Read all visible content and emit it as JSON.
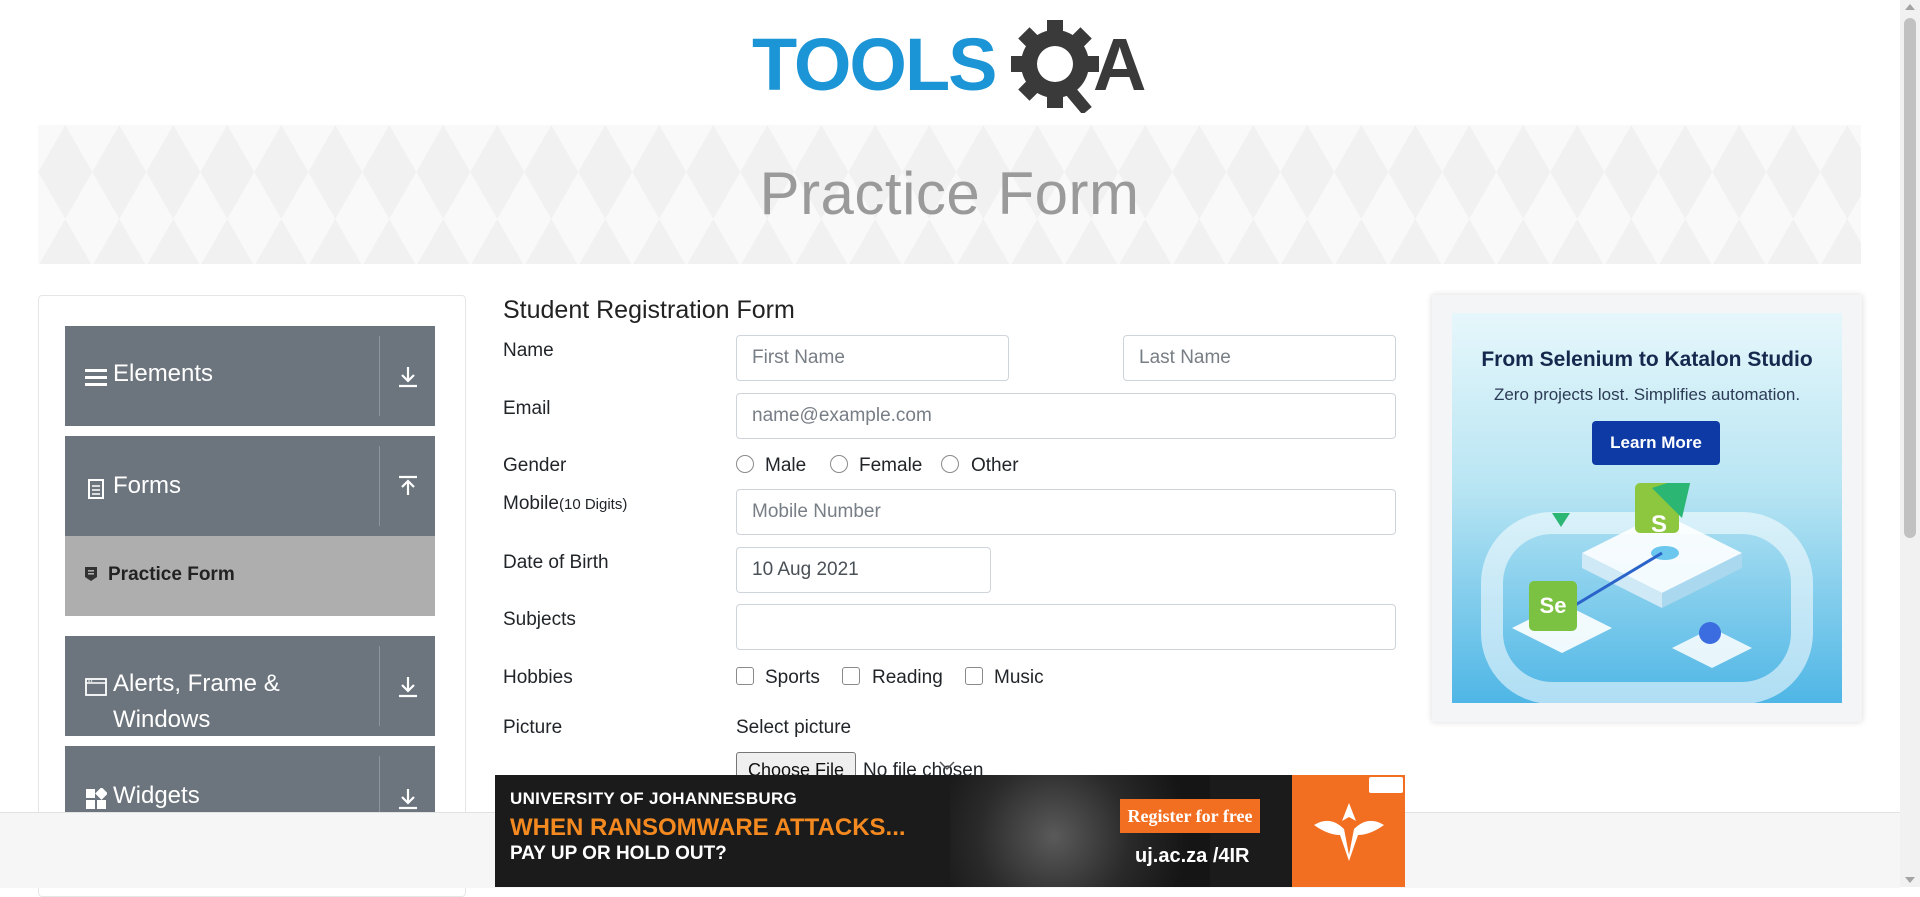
{
  "brand": {
    "logo_text": "TOOLSQA",
    "primary_color": "#1b95d5",
    "dark_color": "#3a3a3a"
  },
  "banner": {
    "title": "Practice Form"
  },
  "sidebar": {
    "groups": [
      {
        "label": "Elements",
        "icon": "menu-icon",
        "state": "collapsed"
      },
      {
        "label": "Forms",
        "icon": "document-icon",
        "state": "expanded"
      },
      {
        "label": "Alerts, Frame &",
        "label2": "Windows",
        "icon": "window-icon",
        "state": "collapsed"
      },
      {
        "label": "Widgets",
        "icon": "widgets-icon",
        "state": "collapsed"
      }
    ],
    "forms_items": [
      {
        "label": "Practice Form",
        "active": true
      }
    ]
  },
  "form": {
    "title": "Student Registration Form",
    "name_label": "Name",
    "first_name_placeholder": "First Name",
    "last_name_placeholder": "Last Name",
    "email_label": "Email",
    "email_placeholder": "name@example.com",
    "gender_label": "Gender",
    "gender_options": [
      "Male",
      "Female",
      "Other"
    ],
    "mobile_label": "Mobile",
    "mobile_hint": "(10 Digits)",
    "mobile_placeholder": "Mobile Number",
    "dob_label": "Date of Birth",
    "dob_value": "10 Aug 2021",
    "subjects_label": "Subjects",
    "subjects_value": "",
    "hobbies_label": "Hobbies",
    "hobbies_options": [
      "Sports",
      "Reading",
      "Music"
    ],
    "picture_label": "Picture",
    "picture_select_label": "Select picture",
    "choose_file_label": "Choose File",
    "no_file_text": "No file chosen"
  },
  "side_ad": {
    "title": "From Selenium to Katalon Studio",
    "subtitle": "Zero projects lost. Simplifies automation.",
    "button": "Learn More",
    "icon_left": "Se",
    "icon_right": "S"
  },
  "bottom_ad": {
    "line1": "UNIVERSITY OF JOHANNESBURG",
    "line2": "WHEN RANSOMWARE ATTACKS...",
    "line3": "PAY UP OR HOLD OUT?",
    "button": "Register for free",
    "url": "uj.ac.za /4IR"
  }
}
